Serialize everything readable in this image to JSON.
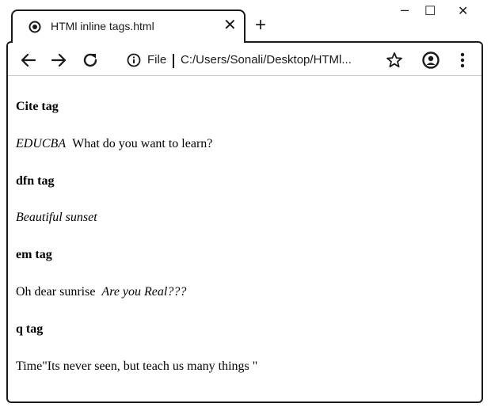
{
  "tab": {
    "title": "HTMl inline tags.html",
    "close_label": "✕",
    "new_tab_label": "+"
  },
  "window_controls": {
    "minimize": "–",
    "maximize": "☐",
    "close": "✕"
  },
  "toolbar": {
    "file_label": "File",
    "url": "C:/Users/Sonali/Desktop/HTMl..."
  },
  "content": {
    "cite_heading": "Cite tag",
    "cite_text": "EDUCBA",
    "cite_question": "What do you want to learn?",
    "dfn_heading": "dfn tag",
    "dfn_text": "Beautiful sunset",
    "em_heading": "em tag",
    "em_plain": "Oh dear sunrise",
    "em_text": "Are you Real???",
    "q_heading": "q tag",
    "q_text": "Time\"Its never seen, but teach us many things \""
  },
  "icons": {
    "tab_favicon": "globe-icon",
    "back": "arrow-left-icon",
    "forward": "arrow-right-icon",
    "reload": "reload-icon",
    "info": "info-icon",
    "bookmark": "star-icon",
    "profile": "account-icon",
    "menu": "kebab-menu-icon"
  }
}
